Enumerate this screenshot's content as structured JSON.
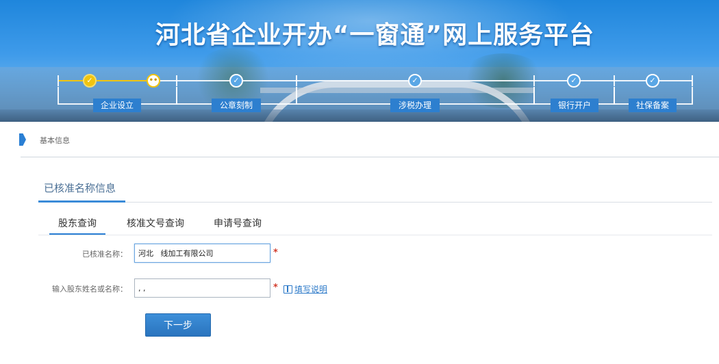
{
  "banner": {
    "title": "河北省企业开办“一窗通”网上服务平台"
  },
  "steps": [
    {
      "label": "企业设立",
      "status": "current"
    },
    {
      "label": "公章刻制",
      "status": "pending"
    },
    {
      "label": "涉税办理",
      "status": "pending"
    },
    {
      "label": "银行开户",
      "status": "pending"
    },
    {
      "label": "社保备案",
      "status": "pending"
    }
  ],
  "breadcrumb": {
    "text": "基本信息"
  },
  "section": {
    "title": "已核准名称信息"
  },
  "tabs": [
    {
      "label": "股东查询",
      "active": true
    },
    {
      "label": "核准文号查询",
      "active": false
    },
    {
      "label": "申请号查询",
      "active": false
    }
  ],
  "form": {
    "approved_name_label": "已核准名称：",
    "approved_name_value": "河北   线加工有限公司",
    "shareholder_label": "输入股东姓名或名称：",
    "shareholder_value": ", ,",
    "required_mark": "*",
    "help_label": "填写说明",
    "next_button": "下一步"
  },
  "icons": {
    "done": "check-icon",
    "current": "ellipsis-icon",
    "help": "book-icon"
  },
  "colors": {
    "accent": "#2a7fd4",
    "done": "#f1c40f",
    "required": "#d23b2b"
  }
}
